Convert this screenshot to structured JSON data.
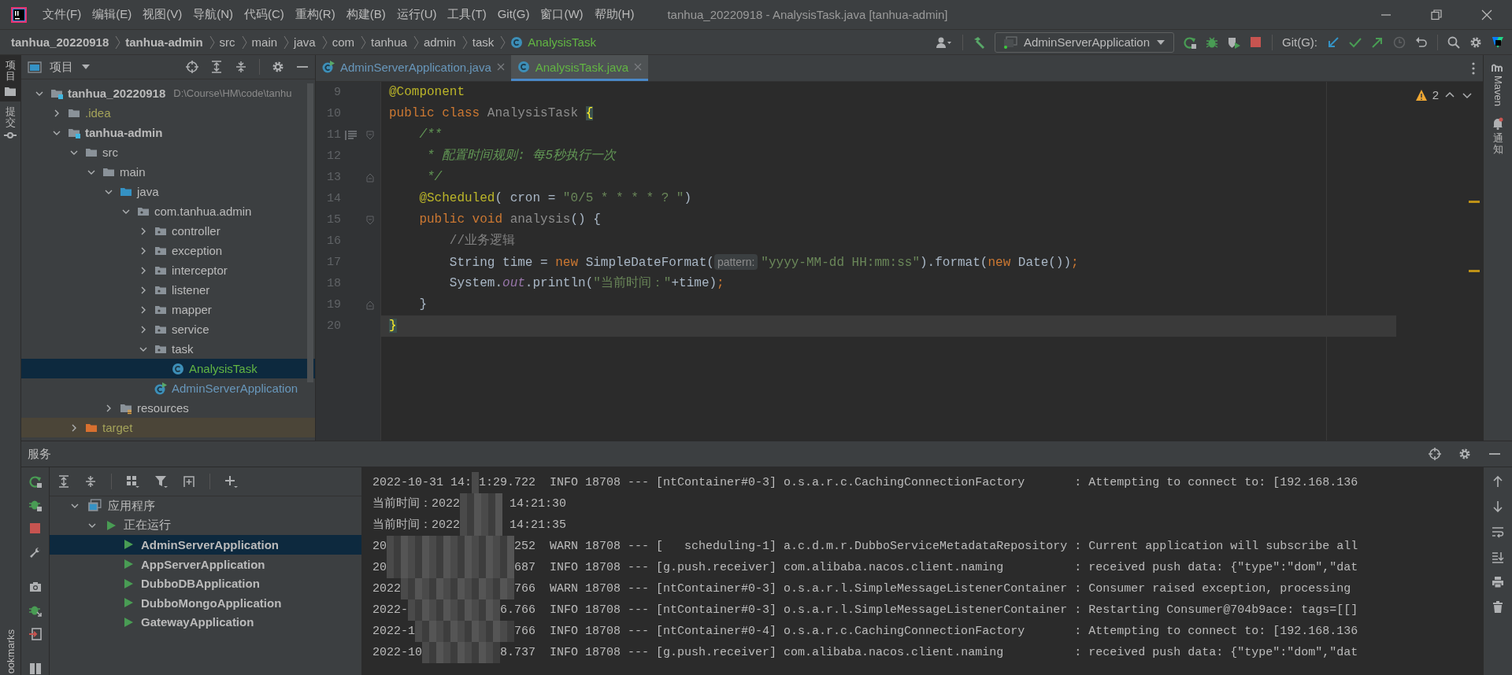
{
  "window": {
    "title": "tanhua_20220918 - AnalysisTask.java [tanhua-admin]"
  },
  "menu": [
    "文件(F)",
    "编辑(E)",
    "视图(V)",
    "导航(N)",
    "代码(C)",
    "重构(R)",
    "构建(B)",
    "运行(U)",
    "工具(T)",
    "Git(G)",
    "窗口(W)",
    "帮助(H)"
  ],
  "breadcrumbs": [
    {
      "label": "tanhua_20220918",
      "kind": "module"
    },
    {
      "label": "tanhua-admin",
      "kind": "module"
    },
    {
      "label": "src",
      "kind": "dir"
    },
    {
      "label": "main",
      "kind": "dir"
    },
    {
      "label": "java",
      "kind": "dir"
    },
    {
      "label": "com",
      "kind": "dir"
    },
    {
      "label": "tanhua",
      "kind": "dir"
    },
    {
      "label": "admin",
      "kind": "dir"
    },
    {
      "label": "task",
      "kind": "dir"
    },
    {
      "label": "AnalysisTask",
      "kind": "class",
      "color": "#62b543"
    }
  ],
  "run_config": {
    "label": "AdminServerApplication"
  },
  "git_label": "Git(G):",
  "left_stripe": [
    {
      "label": "项目",
      "kind": "project",
      "selected": true
    },
    {
      "label": "提交",
      "kind": "commit",
      "selected": false
    }
  ],
  "bookmarks_label": "ookmarks",
  "project_panel": {
    "title": "项目",
    "tree": [
      {
        "label": "tanhua_20220918",
        "kind": "module",
        "path": "D:\\Course\\HM\\code\\tanhu",
        "expanded": true,
        "selected": false,
        "children": [
          {
            "label": ".idea",
            "kind": "folder",
            "color": "#a4a35a",
            "expanded": false,
            "selected": false
          },
          {
            "label": "tanhua-admin",
            "kind": "module",
            "expanded": true,
            "selected": false,
            "children": [
              {
                "label": "src",
                "kind": "folder",
                "expanded": true,
                "selected": false,
                "children": [
                  {
                    "label": "main",
                    "kind": "folder",
                    "expanded": true,
                    "selected": false,
                    "children": [
                      {
                        "label": "java",
                        "kind": "source",
                        "expanded": true,
                        "selected": false,
                        "children": [
                          {
                            "label": "com.tanhua.admin",
                            "kind": "package",
                            "expanded": true,
                            "selected": false,
                            "children": [
                              {
                                "label": "controller",
                                "kind": "package",
                                "expanded": false,
                                "selected": false
                              },
                              {
                                "label": "exception",
                                "kind": "package",
                                "expanded": false,
                                "selected": false
                              },
                              {
                                "label": "interceptor",
                                "kind": "package",
                                "expanded": false,
                                "selected": false
                              },
                              {
                                "label": "listener",
                                "kind": "package",
                                "expanded": false,
                                "selected": false
                              },
                              {
                                "label": "mapper",
                                "kind": "package",
                                "expanded": false,
                                "selected": false
                              },
                              {
                                "label": "service",
                                "kind": "package",
                                "expanded": false,
                                "selected": false
                              },
                              {
                                "label": "task",
                                "kind": "package",
                                "expanded": true,
                                "selected": false,
                                "children": [
                                  {
                                    "label": "AnalysisTask",
                                    "kind": "class",
                                    "color": "#62b543",
                                    "selected": true
                                  }
                                ]
                              },
                              {
                                "label": "AdminServerApplication",
                                "kind": "app",
                                "color": "#6897bb",
                                "selected": false
                              }
                            ]
                          }
                        ]
                      },
                      {
                        "label": "resources",
                        "kind": "resources",
                        "expanded": false,
                        "selected": false
                      }
                    ]
                  }
                ]
              },
              {
                "label": "target",
                "kind": "excluded",
                "color": "#a4a35a",
                "expanded": false,
                "selected": false
              }
            ]
          }
        ]
      }
    ]
  },
  "editor": {
    "tabs": [
      {
        "label": "AdminServerApplication.java",
        "kind": "app",
        "color": "#6897bb",
        "selected": false
      },
      {
        "label": "AnalysisTask.java",
        "kind": "class",
        "color": "#62b543",
        "selected": true
      }
    ],
    "warning_count": "2",
    "lines": [
      {
        "number": "9",
        "tokens": [
          {
            "kind": "annotation",
            "text": "@Component"
          }
        ]
      },
      {
        "number": "10",
        "tokens": [
          {
            "kind": "keyword",
            "text": "public class "
          },
          {
            "kind": "unused",
            "text": "AnalysisTask "
          },
          {
            "kind": "brace",
            "text": "{"
          }
        ]
      },
      {
        "number": "11",
        "fold_start": true,
        "doc_icon": true,
        "tokens": [
          {
            "kind": "doc",
            "text": "    /**"
          }
        ]
      },
      {
        "number": "12",
        "tokens": [
          {
            "kind": "doc",
            "text": "     * 配置时间规则: 每5秒执行一次"
          }
        ]
      },
      {
        "number": "13",
        "fold_end": true,
        "tokens": [
          {
            "kind": "doc",
            "text": "     */"
          }
        ]
      },
      {
        "number": "14",
        "tokens": [
          {
            "kind": "annotation",
            "text": "    @Scheduled"
          },
          {
            "kind": "plain",
            "text": "( cron = "
          },
          {
            "kind": "string",
            "text": "\"0/5 * * * * ? \""
          },
          {
            "kind": "plain",
            "text": ")"
          }
        ]
      },
      {
        "number": "15",
        "fold_start": true,
        "tokens": [
          {
            "kind": "keyword",
            "text": "    public void "
          },
          {
            "kind": "unused",
            "text": "analysis"
          },
          {
            "kind": "plain",
            "text": "() {"
          }
        ]
      },
      {
        "number": "16",
        "tokens": [
          {
            "kind": "comment",
            "text": "        //业务逻辑"
          }
        ]
      },
      {
        "number": "17",
        "tokens": [
          {
            "kind": "plain",
            "text": "        String time = "
          },
          {
            "kind": "keyword",
            "text": "new "
          },
          {
            "kind": "plain",
            "text": "SimpleDateFormat("
          },
          {
            "kind": "hint",
            "text": "pattern:"
          },
          {
            "kind": "string",
            "text": "\"yyyy-MM-dd HH:mm:ss\""
          },
          {
            "kind": "plain",
            "text": ").format("
          },
          {
            "kind": "keyword",
            "text": "new "
          },
          {
            "kind": "plain",
            "text": "Date())"
          },
          {
            "kind": "keyword",
            "text": ";"
          }
        ]
      },
      {
        "number": "18",
        "tokens": [
          {
            "kind": "plain",
            "text": "        System."
          },
          {
            "kind": "field",
            "text": "out"
          },
          {
            "kind": "plain",
            "text": ".println("
          },
          {
            "kind": "string",
            "text": "\"当前时间：\""
          },
          {
            "kind": "plain",
            "text": "+time)"
          },
          {
            "kind": "keyword",
            "text": ";"
          }
        ]
      },
      {
        "number": "19",
        "fold_end": true,
        "tokens": [
          {
            "kind": "plain",
            "text": "    }"
          }
        ]
      },
      {
        "number": "20",
        "current": true,
        "tokens": [
          {
            "kind": "brace",
            "text": "}"
          }
        ]
      }
    ]
  },
  "right_stripe": [
    {
      "label": "Maven",
      "kind": "maven"
    },
    {
      "label": "通知",
      "kind": "notifications"
    }
  ],
  "services": {
    "title": "服务",
    "tree": [
      {
        "label": "应用程序",
        "kind": "group",
        "expanded": true,
        "selected": false,
        "children": [
          {
            "label": "正在运行",
            "kind": "running",
            "expanded": true,
            "selected": false,
            "children": [
              {
                "label": "AdminServerApplication",
                "kind": "app",
                "selected": true
              },
              {
                "label": "AppServerApplication",
                "kind": "app",
                "selected": false
              },
              {
                "label": "DubboDBApplication",
                "kind": "app",
                "selected": false
              },
              {
                "label": "DubboMongoApplication",
                "kind": "app",
                "selected": false
              },
              {
                "label": "GatewayApplication",
                "kind": "app",
                "selected": false
              }
            ]
          }
        ]
      }
    ],
    "console": [
      {
        "kind": "log",
        "lead": "2022-10-31 14:",
        "tail": "1:29.722  INFO 18708 --- [ntContainer#0-3] o.s.a.r.c.CachingConnectionFactory       : Attempting to connect to: [192.168.136"
      },
      {
        "kind": "print",
        "lead": "当前时间：2022",
        "tail": " 14:21:30"
      },
      {
        "kind": "print",
        "lead": "当前时间：2022",
        "tail": " 14:21:35"
      },
      {
        "kind": "log",
        "lead": "20",
        "tail": "252  WARN 18708 --- [   scheduling-1] a.c.d.m.r.DubboServiceMetadataRepository : Current application will subscribe all"
      },
      {
        "kind": "log",
        "lead": "20",
        "tail": "687  INFO 18708 --- [g.push.receiver] com.alibaba.nacos.client.naming          : received push data: {\"type\":\"dom\",\"dat"
      },
      {
        "kind": "log",
        "lead": "2022",
        "tail": "766  WARN 18708 --- [ntContainer#0-3] o.s.a.r.l.SimpleMessageListenerContainer : Consumer raised exception, processing"
      },
      {
        "kind": "log",
        "lead": "2022-",
        "tail": "6.766  INFO 18708 --- [ntContainer#0-3] o.s.a.r.l.SimpleMessageListenerContainer : Restarting Consumer@704b9ace: tags=[[]"
      },
      {
        "kind": "log",
        "lead": "2022-1",
        "tail": "766  INFO 18708 --- [ntContainer#0-4] o.s.a.r.c.CachingConnectionFactory       : Attempting to connect to: [192.168.136"
      },
      {
        "kind": "log",
        "lead": "2022-10",
        "tail": "8.737  INFO 18708 --- [g.push.receiver] com.alibaba.nacos.client.naming          : received push data: {\"type\":\"dom\",\"dat"
      }
    ]
  }
}
